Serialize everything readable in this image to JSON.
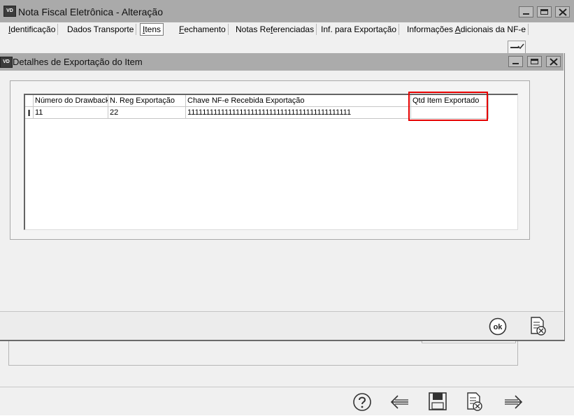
{
  "main_window": {
    "icon_text": "VD",
    "title": "Nota Fiscal Eletrônica - Alteração",
    "tabs": [
      {
        "pre": "",
        "u": "I",
        "post": "dentificação"
      },
      {
        "pre": "Dados Transporte",
        "u": "",
        "post": ""
      },
      {
        "pre": "",
        "u": "I",
        "post": "tens"
      },
      {
        "pre": "",
        "u": "F",
        "post": "echamento"
      },
      {
        "pre": "Notas Re",
        "u": "f",
        "post": "erenciadas"
      },
      {
        "pre": "Inf. para Exportação",
        "u": "",
        "post": ""
      },
      {
        "pre": "Informações ",
        "u": "A",
        "post": "dicionais da NF-e"
      }
    ],
    "active_tab": 2,
    "footer_buttons": [
      "help-icon",
      "back-arrow-icon",
      "save-disk-icon",
      "cancel-document-icon",
      "forward-arrow-icon"
    ]
  },
  "dialog": {
    "icon_text": "VD",
    "title": "Detalhes de Exportação do Item",
    "grid": {
      "columns": [
        "Número do Drawback",
        "N. Reg Exportação",
        "Chave NF-e Recebida Exportação",
        "Qtd Item Exportado"
      ],
      "rows": [
        [
          "11",
          "22",
          "11111111111111111111111111111111111111111111",
          ""
        ]
      ],
      "row_indicator": "I"
    },
    "footer_buttons": [
      "ok-icon",
      "cancel-document-icon"
    ],
    "ok_label": "ok"
  },
  "colors": {
    "titlebar": "#aaaaaa",
    "window_bg": "#f0f0f0",
    "highlight": "#e60000"
  }
}
